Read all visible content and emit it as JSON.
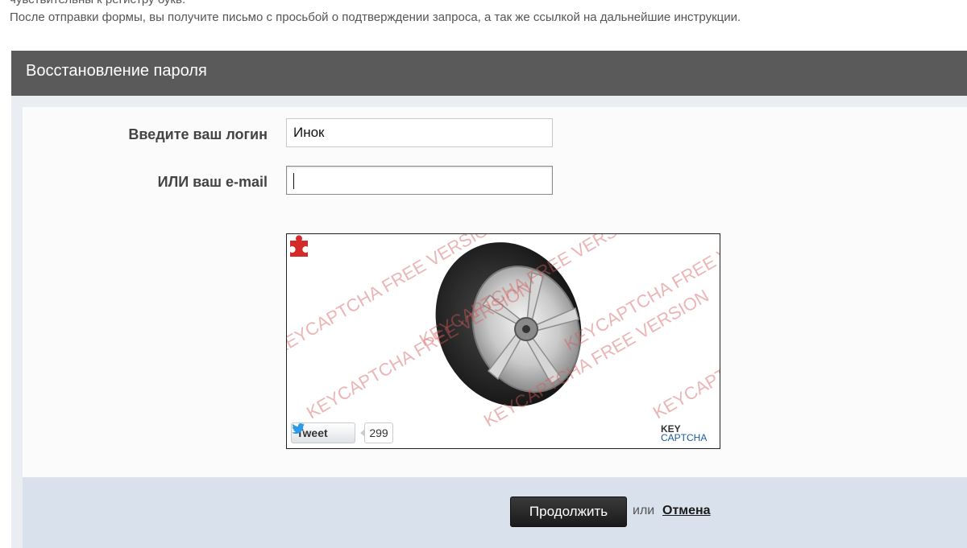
{
  "page": {
    "cutoff_line": "чувствительны к регистру букв.",
    "intro": "После отправки формы, вы получите письмо с просьбой о подтверждении запроса, а так же ссылкой на дальнейшие инструкции."
  },
  "panel": {
    "title": "Восстановление пароля"
  },
  "form": {
    "login_label": "Введите ваш логин",
    "login_value": "Инок",
    "email_label": "ИЛИ ваш e-mail",
    "email_value": ""
  },
  "captcha": {
    "watermark": "KEYCAPTCHA FREE VERSION",
    "tweet_label": "Tweet",
    "tweet_count": "299",
    "logo_line1": "KEY",
    "logo_line2": "CAPTCHA"
  },
  "footer": {
    "continue_label": "Продолжить",
    "or_text": "или",
    "cancel_label": "Отмена"
  },
  "colors": {
    "header_bg": "#5a5a5a",
    "footer_bg": "#d8e1ec",
    "button_bg": "#1a1a1a",
    "watermark": "#d25a5a"
  }
}
